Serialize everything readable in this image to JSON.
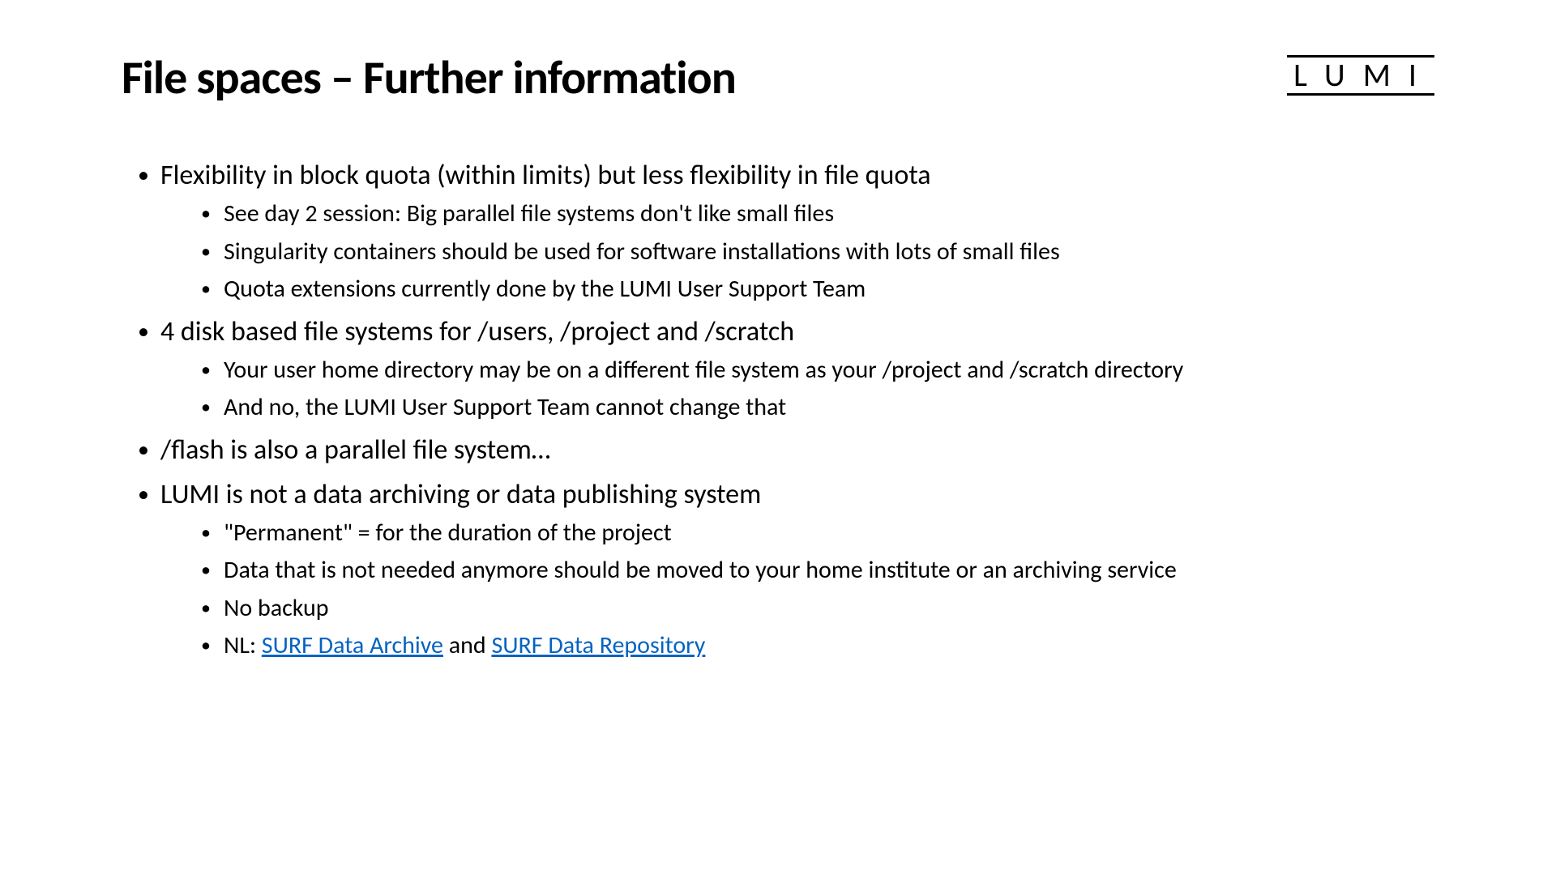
{
  "title": "File spaces – Further information",
  "logo": "LUMI",
  "bullets": {
    "b1": "Flexibility in block quota (within limits) but less flexibility in file quota",
    "b1_1": "See day 2 session: Big parallel file systems don't like small files",
    "b1_2": "Singularity containers should be used for software installations with lots of small files",
    "b1_3": "Quota extensions currently done by the LUMI User Support Team",
    "b2": "4 disk based file systems for /users, /project and /scratch",
    "b2_1": "Your user home directory may be on a different file system as your /project and /scratch directory",
    "b2_2": "And no, the LUMI User Support Team cannot change that",
    "b3": "/flash is also a parallel file system…",
    "b4": "LUMI is not a data archiving or data publishing system",
    "b4_1": "\"Permanent\" = for the duration of the project",
    "b4_2": "Data that is not needed anymore should be moved to your home institute or an archiving service",
    "b4_3": "No backup",
    "b4_4_prefix": "NL: ",
    "b4_4_link1": "SURF Data Archive",
    "b4_4_mid": " and ",
    "b4_4_link2": "SURF Data Repository"
  }
}
